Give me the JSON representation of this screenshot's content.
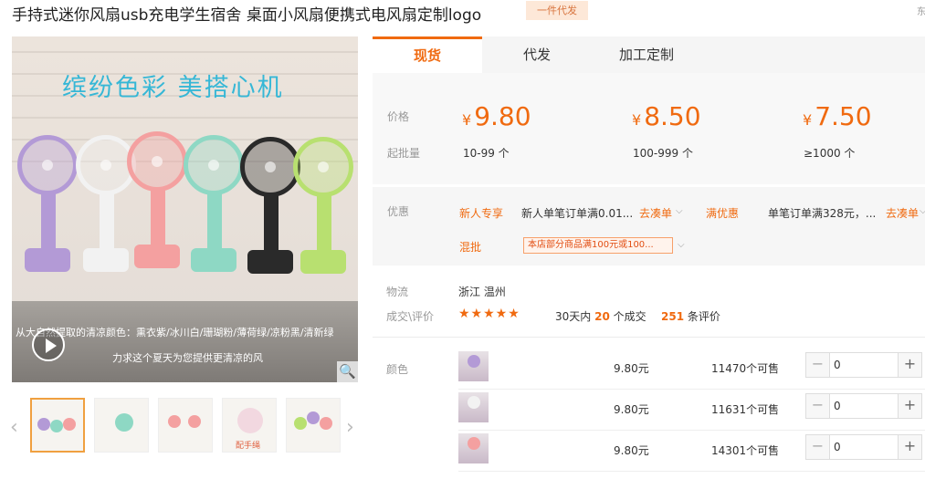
{
  "product": {
    "title": "手持式迷你风扇usb充电学生宿舍 桌面小风扇便携式电风扇定制logo",
    "badge": "一件代发",
    "corner_text": "东"
  },
  "gallery": {
    "headline": "缤纷色彩  美搭心机",
    "caption_line1": "从大自然提取的清凉颜色：熏衣紫/冰川白/珊瑚粉/薄荷绿/凉粉黑/清新绿",
    "caption_line2": "力求这个夏天为您提供更清凉的风",
    "zoom_icon": "🔍",
    "prev_arrow": "‹",
    "next_arrow": "›",
    "thumb_caption": "配手绳",
    "fan_colors": [
      "#b39ad6",
      "#f2f2f2",
      "#f4a0a0",
      "#8ed8c4",
      "#2a2a2a",
      "#b8e070"
    ]
  },
  "tabs": [
    "现货",
    "代发",
    "加工定制"
  ],
  "pricing": {
    "price_label": "价格",
    "moq_label": "起批量",
    "currency": "¥",
    "tiers": [
      {
        "price": "9.80",
        "range": "10-99 个"
      },
      {
        "price": "8.50",
        "range": "100-999 个"
      },
      {
        "price": "7.50",
        "range": "≥1000 个"
      }
    ]
  },
  "promotions": {
    "label": "优惠",
    "new_user_tag": "新人专享",
    "new_user_text": "新人单笔订单满0.01...",
    "collect_link": "去凑单",
    "full_discount_tag": "满优惠",
    "full_discount_text": "单笔订单满328元，...",
    "mix_tag": "混批",
    "coupon_text": "本店部分商品满100元或100..."
  },
  "logistics": {
    "label": "物流",
    "location": "浙江 温州"
  },
  "reviews": {
    "label": "成交\\评价",
    "stars": "★★★★★",
    "period_prefix": "30天内",
    "deals": "20",
    "deals_suffix": "个成交",
    "reviews_count": "251",
    "reviews_suffix": "条评价"
  },
  "sku": {
    "label": "颜色",
    "rows": [
      {
        "price": "9.80元",
        "stock": "11470个可售",
        "qty": "0",
        "color": "#b39ad6"
      },
      {
        "price": "9.80元",
        "stock": "11631个可售",
        "qty": "0",
        "color": "#f2f2f2"
      },
      {
        "price": "9.80元",
        "stock": "14301个可售",
        "qty": "0",
        "color": "#f4a0a0"
      }
    ],
    "minus": "−",
    "plus": "+"
  }
}
